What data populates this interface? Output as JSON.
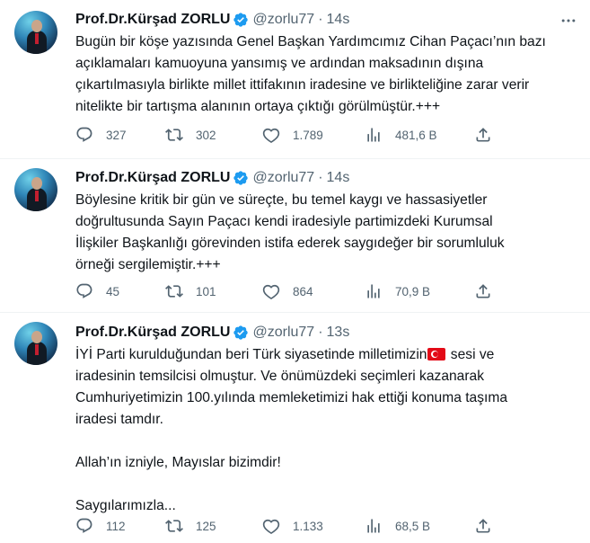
{
  "tweets": [
    {
      "author": "Prof.Dr.Kürşad ZORLU",
      "handle": "@zorlu77",
      "separator": "·",
      "time": "14s",
      "lines": [
        "Bugün bir köşe yazısında Genel Başkan Yardımcımız Cihan Paçacı’nın bazı",
        "açıklamaları kamuoyuna yansımış ve ardından maksadının dışına",
        "çıkartılmasıyla birlikte millet ittifakının iradesine ve birlikteliğine zarar verir",
        "nitelikte bir tartışma alanının ortaya çıktığı görülmüştür.+++"
      ],
      "replies": "327",
      "retweets": "302",
      "likes": "1.789",
      "views": "481,6 B"
    },
    {
      "author": "Prof.Dr.Kürşad ZORLU",
      "handle": "@zorlu77",
      "separator": "·",
      "time": "14s",
      "lines": [
        "Böylesine kritik bir gün ve süreçte, bu temel kaygı ve hassasiyetler",
        "doğrultusunda Sayın Paçacı kendi iradesiyle partimizdeki Kurumsal",
        "İlişkiler Başkanlığı görevinden istifa ederek saygıdeğer bir sorumluluk",
        "örneği sergilemiştir.+++"
      ],
      "replies": "45",
      "retweets": "101",
      "likes": "864",
      "views": "70,9 B"
    },
    {
      "author": "Prof.Dr.Kürşad ZORLU",
      "handle": "@zorlu77",
      "separator": "·",
      "time": "13s",
      "line1_before_flag": "İYİ Parti kurulduğundan beri Türk siyasetinde milletimizin",
      "line1_after_flag": " sesi ve",
      "lines_rest": [
        "iradesinin temsilcisi olmuştur. Ve önümüzdeki seçimleri kazanarak",
        "Cumhuriyetimizin 100.yılında memleketimizi hak ettiği konuma taşıma",
        "iradesi tamdır."
      ],
      "paragraph2": "Allah’ın izniyle, Mayıslar bizimdir!",
      "paragraph3": "Saygılarımızla...",
      "replies": "112",
      "retweets": "125",
      "likes": "1.133",
      "views": "68,5 B"
    }
  ],
  "icons": {
    "verified": "verified-badge-icon",
    "more": "more-icon",
    "reply": "reply-icon",
    "retweet": "retweet-icon",
    "like": "like-icon",
    "views": "views-icon",
    "share": "share-icon"
  },
  "colors": {
    "text": "#0f1419",
    "secondary": "#536471",
    "verified": "#1d9bf0",
    "divider": "#eff3f4"
  }
}
